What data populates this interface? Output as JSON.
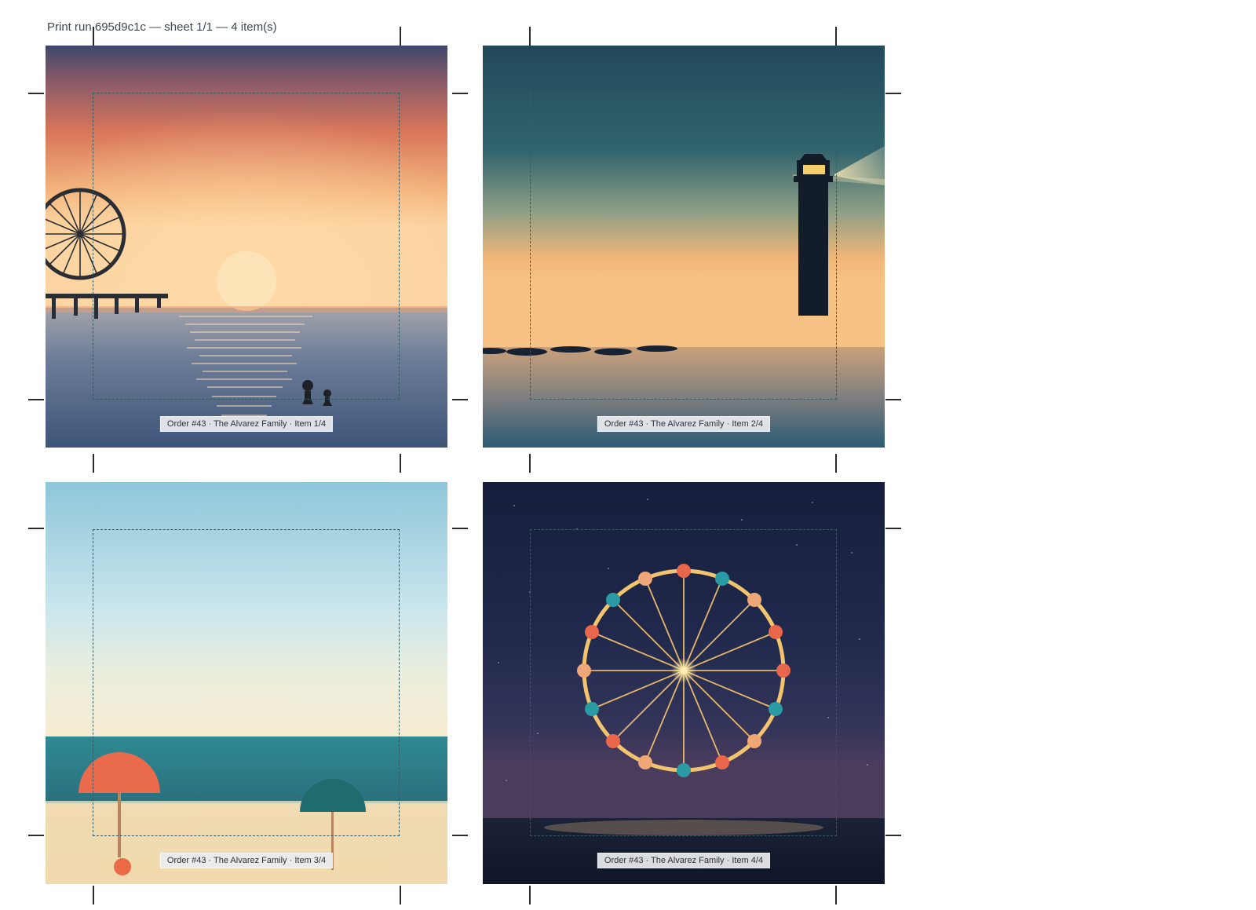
{
  "sheet": {
    "header": "Print run 695d9c1c — sheet 1/1 — 4 item(s)"
  },
  "items": [
    {
      "label": "Order #43 · The Alvarez Family · Item 1/4",
      "scene": "sunset-pier-ferris-wheel"
    },
    {
      "label": "Order #43 · The Alvarez Family · Item 2/4",
      "scene": "dusk-lighthouse-stepping-stones"
    },
    {
      "label": "Order #43 · The Alvarez Family · Item 3/4",
      "scene": "daytime-beach-umbrellas"
    },
    {
      "label": "Order #43 · The Alvarez Family · Item 4/4",
      "scene": "night-ferris-wheel"
    }
  ],
  "colors": {
    "safe_zone": "#365c63",
    "crop_marks": "#2a2a2a",
    "label_bg": "#e9ecf0"
  }
}
